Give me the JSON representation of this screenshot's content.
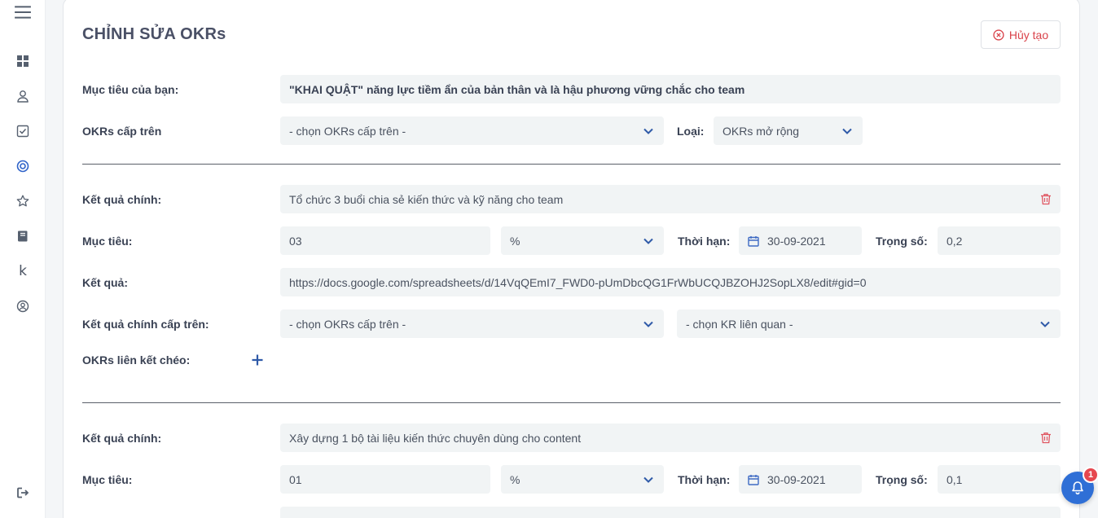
{
  "page_title": "CHỈNH SỬA OKRs",
  "cancel_label": "Hủy tạo",
  "objective": {
    "label": "Mục tiêu của bạn:",
    "value": "\"KHAI QUẬT\" năng lực tiềm ẩn của bản thân và là hậu phương vững chắc cho team"
  },
  "parent_okr": {
    "label": "OKRs cấp trên",
    "placeholder": "- chọn OKRs cấp trên -",
    "type_label": "Loại:",
    "type_value": "OKRs mở rộng"
  },
  "key_results": [
    {
      "kr_label": "Kết quả chính:",
      "kr_value": "Tổ chức 3 buổi chia sẻ kiến thức và kỹ năng cho team",
      "target_label": "Mục tiêu:",
      "target_value": "03",
      "unit": "%",
      "deadline_label": "Thời hạn:",
      "deadline": "30-09-2021",
      "weight_label": "Trọng số:",
      "weight": "0,2",
      "result_label": "Kết quả:",
      "result_value": "https://docs.google.com/spreadsheets/d/14VqQEmI7_FWD0-pUmDbcQG1FrWbUCQJBZOHJ2SopLX8/edit#gid=0",
      "parent_kr_label": "Kết quả chính cấp trên:",
      "parent_okr_placeholder": "- chọn OKRs cấp trên -",
      "related_kr_placeholder": "- chọn KR liên quan -",
      "cross_link_label": "OKRs liên kết chéo:"
    },
    {
      "kr_label": "Kết quả chính:",
      "kr_value": "Xây dựng 1 bộ tài liệu kiến thức chuyên dùng cho content",
      "target_label": "Mục tiêu:",
      "target_value": "01",
      "unit": "%",
      "deadline_label": "Thời hạn:",
      "deadline": "30-09-2021",
      "weight_label": "Trọng số:",
      "weight": "0,1"
    }
  ],
  "sidebar": {
    "k_letter": "k"
  },
  "notification_count": "1",
  "icons": [
    "menu-icon",
    "dashboard-icon",
    "user-icon",
    "checklist-icon",
    "target-icon",
    "star-icon",
    "book-icon",
    "k-icon",
    "account-icon",
    "logout-icon",
    "cancel-circle-icon",
    "chevron-down-icon",
    "trash-icon",
    "calendar-icon",
    "plus-icon",
    "bell-icon"
  ],
  "colors": {
    "accent": "#2f6fd6",
    "danger": "#d9434b",
    "field_bg": "#f1f4f5"
  }
}
